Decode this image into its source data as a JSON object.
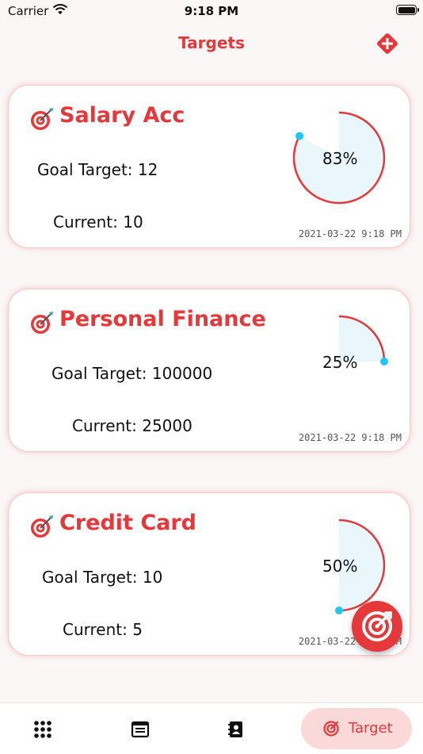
{
  "status_bar": {
    "carrier": "Carrier",
    "time": "9:18 PM"
  },
  "header": {
    "title": "Targets"
  },
  "colors": {
    "accent": "#e5383b",
    "gauge_fill": "#e9f7fc",
    "gauge_dot": "#1ec8f0",
    "active_tab_bg": "#fbd9d9"
  },
  "targets": [
    {
      "title": "Salary Acc",
      "goal_label": "Goal Target: 12",
      "current_label": "Current: 10",
      "percent_label": "83%",
      "progress": 0.83,
      "timestamp": "2021-03-22 9:18 PM"
    },
    {
      "title": "Personal Finance",
      "goal_label": "Goal Target: 100000",
      "current_label": "Current: 25000",
      "percent_label": "25%",
      "progress": 0.25,
      "timestamp": "2021-03-22 9:18 PM"
    },
    {
      "title": "Credit Card",
      "goal_label": "Goal Target: 10",
      "current_label": "Current: 5",
      "percent_label": "50%",
      "progress": 0.5,
      "timestamp": "2021-03-22 9:18 PM"
    }
  ],
  "tab_bar": {
    "items": [
      {
        "icon": "grid-icon"
      },
      {
        "icon": "list-icon"
      },
      {
        "icon": "contacts-icon"
      },
      {
        "icon": "target-icon",
        "label": "Target",
        "active": true
      }
    ]
  },
  "fab": {
    "icon": "target-icon"
  }
}
